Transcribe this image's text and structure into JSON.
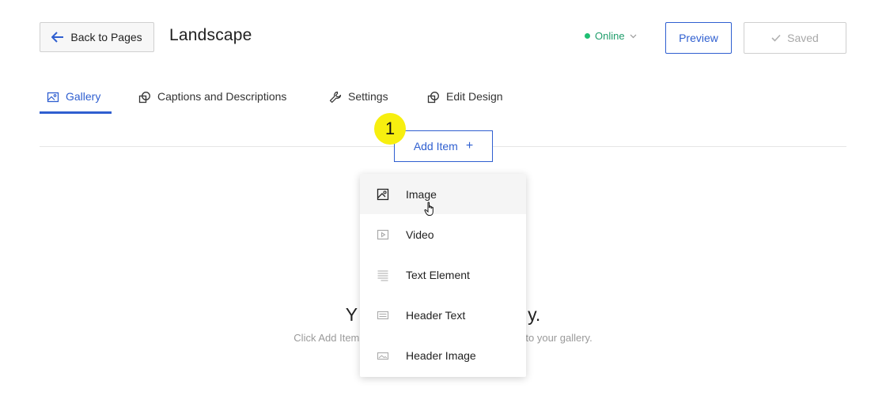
{
  "header": {
    "back_label": "Back to Pages",
    "title": "Landscape",
    "status": "Online",
    "preview_label": "Preview",
    "saved_label": "Saved"
  },
  "tabs": [
    {
      "label": "Gallery",
      "icon": "image-icon",
      "active": true
    },
    {
      "label": "Captions and Descriptions",
      "icon": "overlap-icon",
      "active": false
    },
    {
      "label": "Settings",
      "icon": "wrench-icon",
      "active": false
    },
    {
      "label": "Edit Design",
      "icon": "overlap-icon",
      "active": false
    }
  ],
  "add_item": {
    "label": "Add Item",
    "plus": "+"
  },
  "step_badge": "1",
  "empty_state": {
    "title_left": "Y",
    "title_right": "y.",
    "desc_left": "Click Add Item",
    "desc_right": "to your gallery."
  },
  "menu": {
    "items": [
      {
        "label": "Image",
        "icon": "image-icon",
        "hover": true
      },
      {
        "label": "Video",
        "icon": "video-icon",
        "hover": false
      },
      {
        "label": "Text Element",
        "icon": "text-lines-icon",
        "hover": false
      },
      {
        "label": "Header Text",
        "icon": "header-text-icon",
        "hover": false
      },
      {
        "label": "Header Image",
        "icon": "header-image-icon",
        "hover": false
      }
    ]
  },
  "colors": {
    "accent": "#2f5fd0",
    "online": "#1fbf73",
    "badge": "#f7ef0f"
  }
}
